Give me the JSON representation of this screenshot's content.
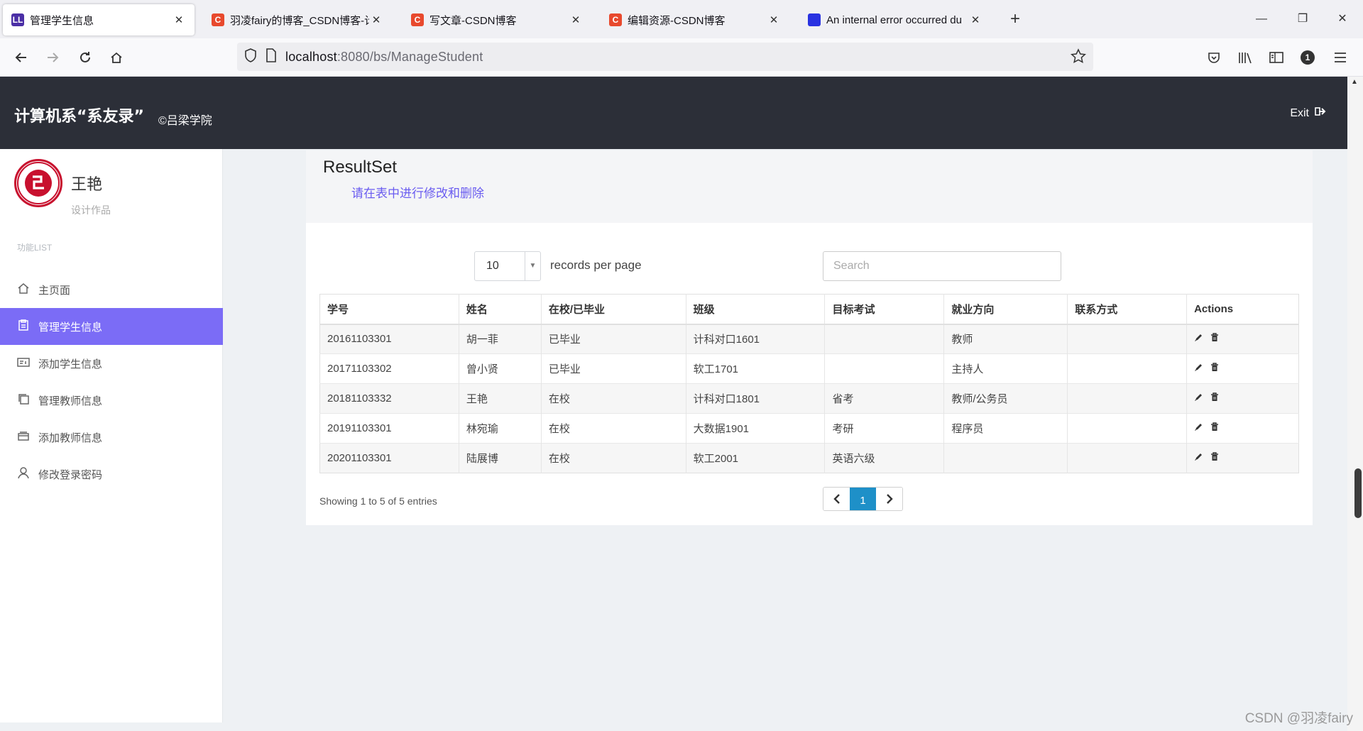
{
  "browser": {
    "tabs": [
      {
        "title": "管理学生信息",
        "favicon_color": "#4b2fa6",
        "favicon_text": "LL",
        "active": true
      },
      {
        "title": "羽凌fairy的博客_CSDN博客-计",
        "favicon_color": "#e8492d",
        "favicon_text": "C",
        "active": false
      },
      {
        "title": "写文章-CSDN博客",
        "favicon_color": "#e8492d",
        "favicon_text": "C",
        "active": false
      },
      {
        "title": "编辑资源-CSDN博客",
        "favicon_color": "#e8492d",
        "favicon_text": "C",
        "active": false
      },
      {
        "title": "An internal error occurred du",
        "favicon_color": "#2932e1",
        "favicon_text": "",
        "active": false
      }
    ],
    "url_host": "localhost",
    "url_rest": ":8080/bs/ManageStudent",
    "notification_count": "1"
  },
  "header": {
    "brand": "计算机系“系友录”",
    "subtitle": "©吕梁学院",
    "exit_label": "Exit"
  },
  "sidebar": {
    "profile_name": "王艳",
    "profile_role": "设计作品",
    "section_label": "功能LIST",
    "items": [
      {
        "label": "主页面",
        "icon": "home-icon",
        "active": false
      },
      {
        "label": "管理学生信息",
        "icon": "clipboard-icon",
        "active": true
      },
      {
        "label": "添加学生信息",
        "icon": "id-card-icon",
        "active": false
      },
      {
        "label": "管理教师信息",
        "icon": "copy-icon",
        "active": false
      },
      {
        "label": "添加教师信息",
        "icon": "card-stack-icon",
        "active": false
      },
      {
        "label": "修改登录密码",
        "icon": "user-icon",
        "active": false
      }
    ]
  },
  "main": {
    "title": "ResultSet",
    "subtitle": "请在表中进行修改和删除",
    "per_page_value": "10",
    "per_page_label": "records per page",
    "search_placeholder": "Search",
    "columns": [
      "学号",
      "姓名",
      "在校/已毕业",
      "班级",
      "目标考试",
      "就业方向",
      "联系方式",
      "Actions"
    ],
    "rows": [
      [
        "20161103301",
        "胡一菲",
        "已毕业",
        "计科对口1601",
        "",
        "教师",
        ""
      ],
      [
        "20171103302",
        "曾小贤",
        "已毕业",
        "软工1701",
        "",
        "主持人",
        ""
      ],
      [
        "20181103332",
        "王艳",
        "在校",
        "计科对口1801",
        "省考",
        "教师/公务员",
        ""
      ],
      [
        "20191103301",
        "林宛瑜",
        "在校",
        "大数据1901",
        "考研",
        "程序员",
        ""
      ],
      [
        "20201103301",
        "陆展博",
        "在校",
        "软工2001",
        "英语六级",
        "",
        ""
      ]
    ],
    "showing_text": "Showing 1 to 5 of 5 entries",
    "current_page": "1"
  },
  "watermark": "CSDN @羽凌fairy"
}
